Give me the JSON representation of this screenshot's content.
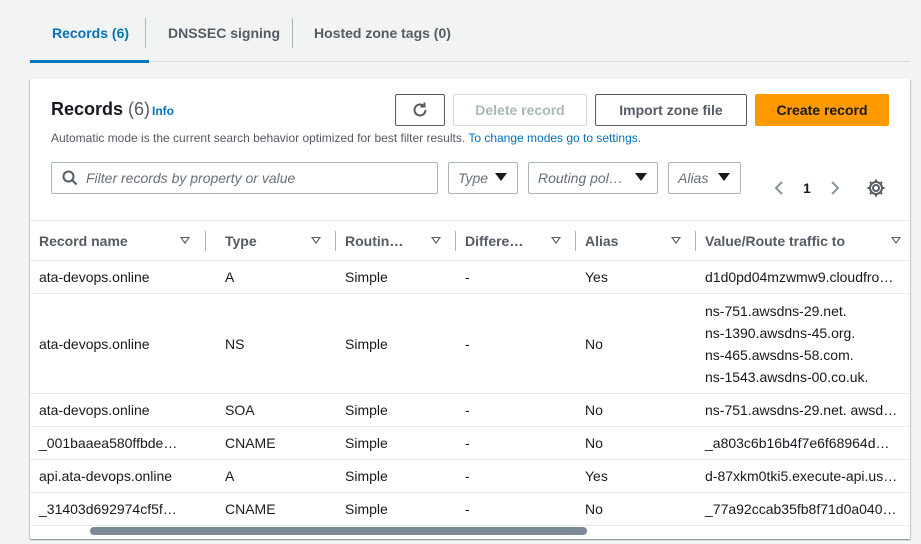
{
  "tabs": [
    {
      "label": "Records (6)",
      "active": true
    },
    {
      "label": "DNSSEC signing",
      "active": false
    },
    {
      "label": "Hosted zone tags (0)",
      "active": false
    }
  ],
  "panel": {
    "title": "Records",
    "count": "(6)",
    "info_label": "Info",
    "description": "Automatic mode is the current search behavior optimized for best filter results.",
    "description_link": "To change modes go to settings."
  },
  "actions": {
    "delete_label": "Delete record",
    "import_label": "Import zone file",
    "create_label": "Create record"
  },
  "filters": {
    "search_placeholder": "Filter records by property or value",
    "type": "Type",
    "routing_policy": "Routing pol…",
    "alias": "Alias"
  },
  "pagination": {
    "current_page": "1"
  },
  "table": {
    "columns": [
      "Record name",
      "Type",
      "Routin…",
      "Differe…",
      "Alias",
      "Value/Route traffic to"
    ],
    "rows": [
      {
        "name": "ata-devops.online",
        "type": "A",
        "routing": "Simple",
        "differentiator": "-",
        "alias": "Yes",
        "value": [
          "d1d0pd04mzwmw9.cloudfro…"
        ]
      },
      {
        "name": "ata-devops.online",
        "type": "NS",
        "routing": "Simple",
        "differentiator": "-",
        "alias": "No",
        "value": [
          "ns-751.awsdns-29.net.",
          "ns-1390.awsdns-45.org.",
          "ns-465.awsdns-58.com.",
          "ns-1543.awsdns-00.co.uk."
        ]
      },
      {
        "name": "ata-devops.online",
        "type": "SOA",
        "routing": "Simple",
        "differentiator": "-",
        "alias": "No",
        "value": [
          "ns-751.awsdns-29.net. awsd…"
        ]
      },
      {
        "name": "_001baaea580ffbde…",
        "type": "CNAME",
        "routing": "Simple",
        "differentiator": "-",
        "alias": "No",
        "value": [
          "_a803c6b16b4f7e6f68964d…"
        ]
      },
      {
        "name": "api.ata-devops.online",
        "type": "A",
        "routing": "Simple",
        "differentiator": "-",
        "alias": "Yes",
        "value": [
          "d-87xkm0tki5.execute-api.us…"
        ]
      },
      {
        "name": "_31403d692974cf5f…",
        "type": "CNAME",
        "routing": "Simple",
        "differentiator": "-",
        "alias": "No",
        "value": [
          "_77a92ccab35fb8f71d0a040…"
        ]
      }
    ]
  },
  "colors": {
    "accent": "#0073bb",
    "primary_button": "#ff9900"
  },
  "icons": [
    "refresh-icon",
    "search-icon",
    "chevron-left-icon",
    "chevron-right-icon",
    "gear-icon",
    "sort-icon",
    "caret-down-icon"
  ]
}
